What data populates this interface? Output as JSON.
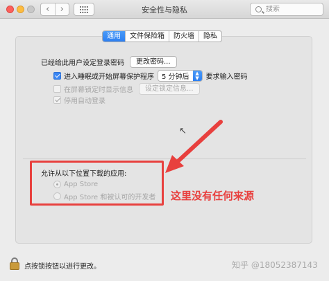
{
  "window": {
    "title": "安全性与隐私",
    "search_placeholder": "搜索"
  },
  "tabs": [
    {
      "label": "通用",
      "active": true
    },
    {
      "label": "文件保险箱",
      "active": false
    },
    {
      "label": "防火墙",
      "active": false
    },
    {
      "label": "隐私",
      "active": false
    }
  ],
  "general": {
    "password_label": "已经给此用户设定登录密码",
    "change_password_button": "更改密码...",
    "require_password": {
      "checked": true,
      "prefix": "进入睡眠或开始屏幕保护程序",
      "delay_value": "5 分钟后",
      "suffix": "要求输入密码"
    },
    "lock_message": {
      "checked": false,
      "label": "在屏幕锁定时显示信息",
      "button": "设定锁定信息..."
    },
    "disable_auto_login": {
      "checked": true,
      "label": "停用自动登录"
    }
  },
  "downloads": {
    "heading": "允许从以下位置下载的应用:",
    "options": [
      {
        "label": "App Store",
        "selected": true
      },
      {
        "label": "App Store 和被认可的开发者",
        "selected": false
      }
    ]
  },
  "annotation": {
    "text": "这里没有任何来源",
    "color": "#e8403e"
  },
  "footer": {
    "lock_text": "点按锁按钮以进行更改。",
    "watermark": "知乎 @18052387143"
  },
  "colors": {
    "accent": "#2d7ff1",
    "annotation_red": "#e8403e"
  }
}
